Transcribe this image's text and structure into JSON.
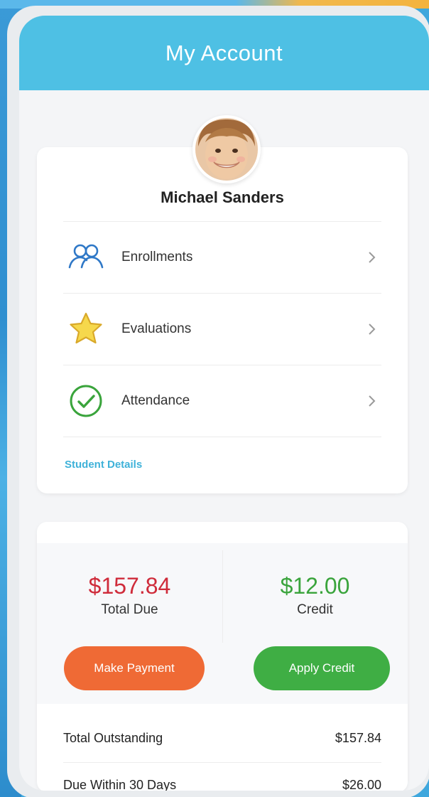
{
  "header": {
    "title": "My Account"
  },
  "student": {
    "name": "Michael Sanders",
    "menu": [
      {
        "label": "Enrollments",
        "icon": "people-icon"
      },
      {
        "label": "Evaluations",
        "icon": "star-icon"
      },
      {
        "label": "Attendance",
        "icon": "check-circle-icon"
      }
    ],
    "details_link": "Student Details"
  },
  "billing": {
    "total_due_amount": "$157.84",
    "total_due_label": "Total Due",
    "credit_amount": "$12.00",
    "credit_label": "Credit",
    "make_payment_label": "Make Payment",
    "apply_credit_label": "Apply Credit",
    "summary": [
      {
        "label": "Total Outstanding",
        "value": "$157.84"
      },
      {
        "label": "Due Within 30 Days",
        "value": "$26.00"
      }
    ]
  },
  "colors": {
    "header": "#4ec0e4",
    "due": "#cf2b3a",
    "credit": "#3aa43c",
    "payment_button": "#ef6a35",
    "credit_button": "#3fae44",
    "link": "#3fb2d9"
  }
}
